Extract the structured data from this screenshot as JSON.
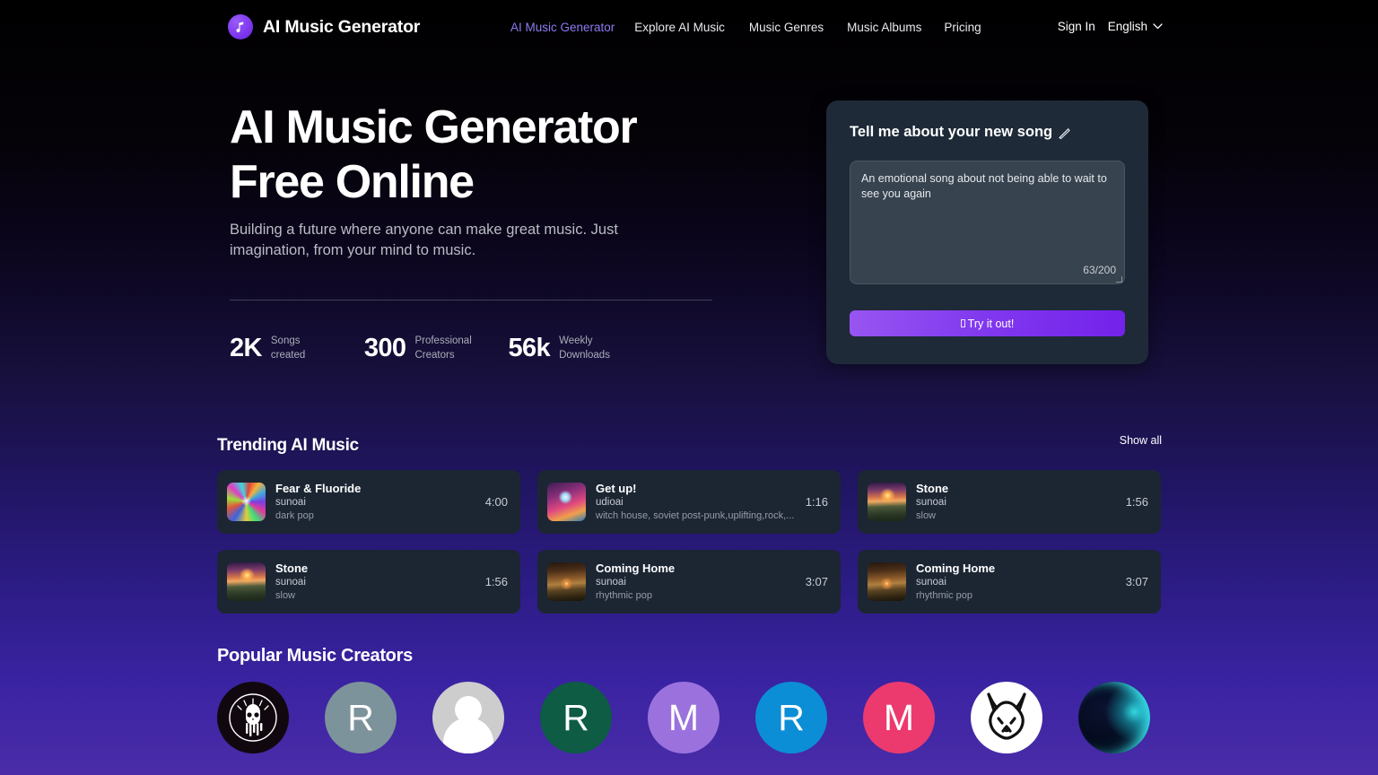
{
  "nav": {
    "brand": "AI Music Generator",
    "logo_icon": "music-note-icon",
    "links": [
      {
        "label": "AI Music Generator",
        "active": true
      },
      {
        "label": "Explore AI Music",
        "active": false
      },
      {
        "label": "Music Genres",
        "active": false
      },
      {
        "label": "Music Albums",
        "active": false
      },
      {
        "label": "Pricing",
        "active": false
      }
    ],
    "sign_in": "Sign In",
    "language": "English",
    "chevron_icon": "chevron-down-icon",
    "active_color": "#8b7cf0"
  },
  "hero": {
    "title_line1": "AI Music Generator",
    "title_line2": "Free Online",
    "subtitle": "Building a future where anyone can make great music. Just imagination, from your mind to music.",
    "stats": [
      {
        "value": "2K",
        "label": "Songs created"
      },
      {
        "value": "300",
        "label": "Professional Creators"
      },
      {
        "value": "56k",
        "label": "Weekly Downloads"
      }
    ]
  },
  "prompt_card": {
    "title": "Tell me about your new song",
    "title_icon": "pencil-icon",
    "textarea_value": "An emotional song about not being able to wait to see you again",
    "textarea_placeholder": "Tell me about your new song",
    "counter": "63/200",
    "cta_label": "Try it out!",
    "cta_icon": "missing-glyph-icon",
    "accent_color": "#8139ef",
    "card_bg": "#1e2a38"
  },
  "trending": {
    "title": "Trending AI Music",
    "show_all": "Show all",
    "tracks": [
      {
        "title": "Fear & Fluoride",
        "artist": "sunoai",
        "genre": "dark pop",
        "duration": "4:00",
        "art": "th-burst"
      },
      {
        "title": "Get up!",
        "artist": "udioai",
        "genre": "witch house, soviet post-punk,uplifting,rock,...",
        "duration": "1:16",
        "art": "th-cat"
      },
      {
        "title": "Stone",
        "artist": "sunoai",
        "genre": "slow",
        "duration": "1:56",
        "art": "th-sunset"
      },
      {
        "title": "Stone",
        "artist": "sunoai",
        "genre": "slow",
        "duration": "1:56",
        "art": "th-sunset"
      },
      {
        "title": "Coming Home",
        "artist": "sunoai",
        "genre": "rhythmic pop",
        "duration": "3:07",
        "art": "th-road"
      },
      {
        "title": "Coming Home",
        "artist": "sunoai",
        "genre": "rhythmic pop",
        "duration": "3:07",
        "art": "th-road"
      }
    ]
  },
  "creators": {
    "title": "Popular Music Creators",
    "avatars": [
      {
        "kind": "skull",
        "letter": "",
        "color": "#11080f",
        "name": "avatar-skull"
      },
      {
        "kind": "letter",
        "letter": "R",
        "color": "#7d939b",
        "name": "avatar-letter-r-grey"
      },
      {
        "kind": "person",
        "letter": "",
        "color": "#cdcdcd",
        "name": "avatar-person-placeholder"
      },
      {
        "kind": "letter",
        "letter": "R",
        "color": "#0d5c43",
        "name": "avatar-letter-r-green"
      },
      {
        "kind": "letter",
        "letter": "M",
        "color": "#9b72dd",
        "name": "avatar-letter-m-purple"
      },
      {
        "kind": "letter",
        "letter": "R",
        "color": "#0b8ed6",
        "name": "avatar-letter-r-blue"
      },
      {
        "kind": "letter",
        "letter": "M",
        "color": "#ec3a6e",
        "name": "avatar-letter-m-pink"
      },
      {
        "kind": "wolf",
        "letter": "",
        "color": "#ffffff",
        "name": "avatar-wolf"
      },
      {
        "kind": "moon",
        "letter": "",
        "color": "#06101f",
        "name": "avatar-moon"
      }
    ]
  }
}
